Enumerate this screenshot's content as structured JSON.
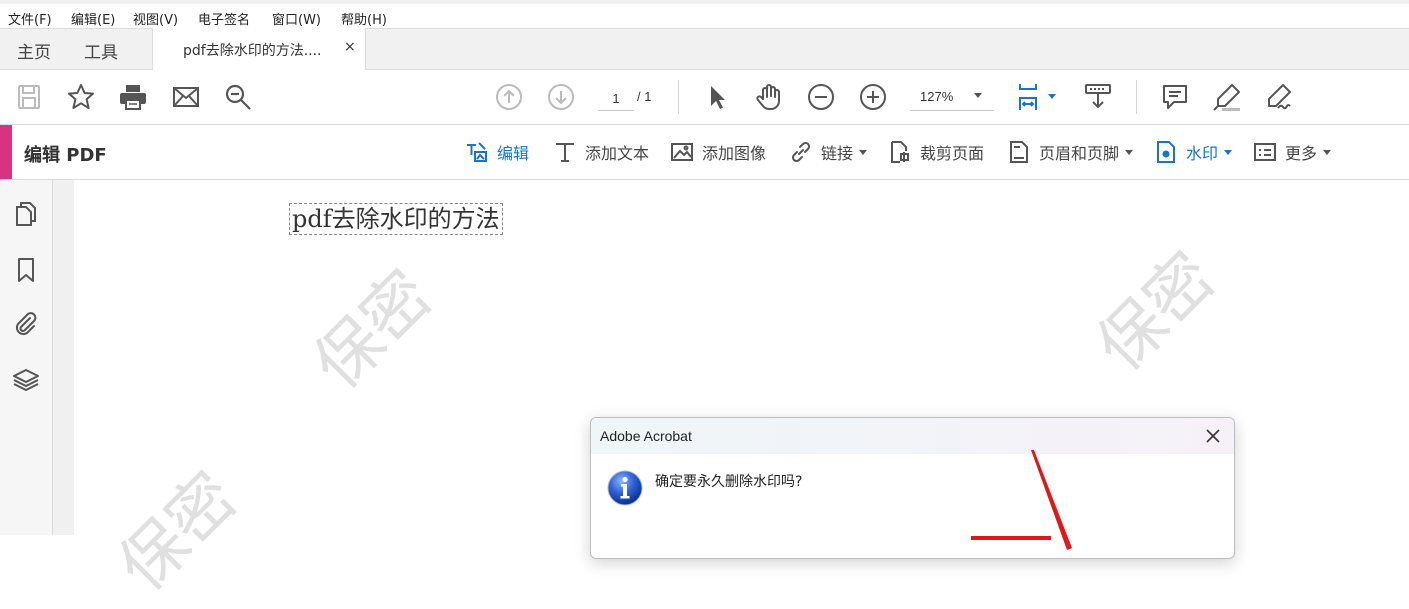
{
  "menu": [
    "文件(F)",
    "编辑(E)",
    "视图(V)",
    "电子签名",
    "窗口(W)",
    "帮助(H)"
  ],
  "tabs": {
    "home": "主页",
    "tools": "工具",
    "document": "pdf去除水印的方法....",
    "close": "×"
  },
  "toolbar": {
    "save": "save-icon",
    "bookmark": "star-icon",
    "print": "printer-icon",
    "email": "mail-icon",
    "search": "search-zoom-icon",
    "page_current": "1",
    "page_total": "/ 1",
    "zoom": "127%"
  },
  "editbar": {
    "title": "编辑 PDF",
    "edit": "编辑",
    "add_text": "添加文本",
    "add_image": "添加图像",
    "link": "链接",
    "crop": "裁剪页面",
    "header_footer": "页眉和页脚",
    "watermark": "水印",
    "more": "更多"
  },
  "document": {
    "text": "pdf去除水印的方法",
    "watermark_text": "保密"
  },
  "dialog": {
    "title": "Adobe Acrobat",
    "message": "确定要永久删除水印吗?",
    "close": "close-icon",
    "icon": "info-icon"
  },
  "colors": {
    "accent": "#d6347f",
    "active_blue": "#1a73c8",
    "annotation_red": "#e21818"
  }
}
